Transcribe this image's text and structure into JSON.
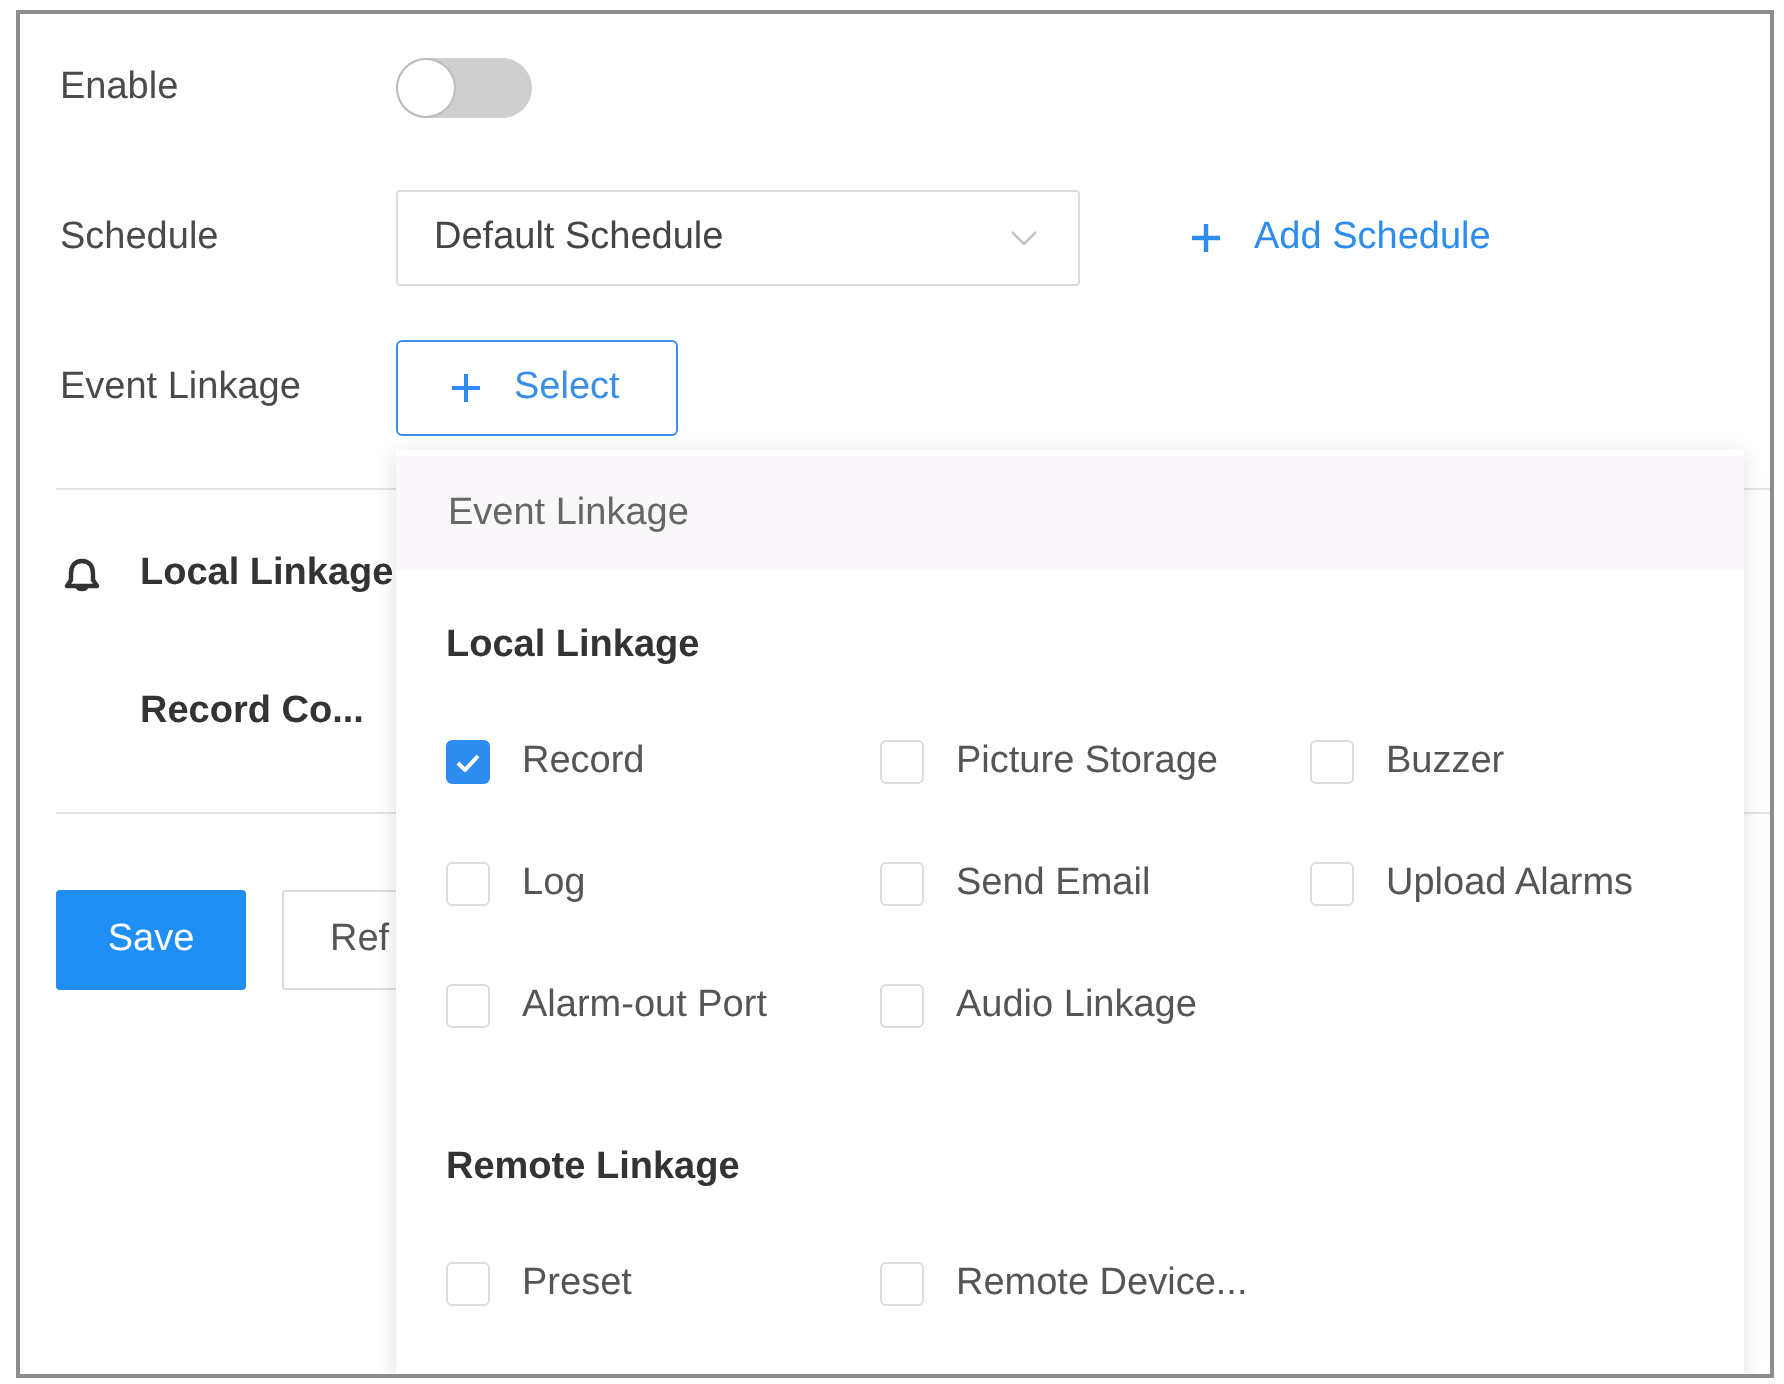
{
  "settings": {
    "enable": {
      "label": "Enable",
      "on": false
    },
    "schedule": {
      "label": "Schedule",
      "value": "Default Schedule",
      "add_link": "Add Schedule"
    },
    "event_linkage": {
      "label": "Event Linkage",
      "button": "Select"
    }
  },
  "local_linkage": {
    "title": "Local Linkage",
    "rows": [
      {
        "label": "Record Co..."
      }
    ]
  },
  "buttons": [
    {
      "label": "Save",
      "kind": "primary"
    },
    {
      "label": "Ref",
      "kind": "default"
    }
  ],
  "event_linkage_popup": {
    "title": "Event Linkage",
    "groups": [
      {
        "title": "Local Linkage",
        "options": [
          {
            "label": "Record",
            "checked": true
          },
          {
            "label": "Picture Storage",
            "checked": false
          },
          {
            "label": "Buzzer",
            "checked": false
          },
          {
            "label": "Log",
            "checked": false
          },
          {
            "label": "Send Email",
            "checked": false
          },
          {
            "label": "Upload Alarms",
            "checked": false
          },
          {
            "label": "Alarm-out Port",
            "checked": false
          },
          {
            "label": "Audio Linkage",
            "checked": false
          }
        ]
      },
      {
        "title": "Remote Linkage",
        "options": [
          {
            "label": "Preset",
            "checked": false
          },
          {
            "label": "Remote Device...",
            "checked": false
          }
        ]
      }
    ]
  }
}
